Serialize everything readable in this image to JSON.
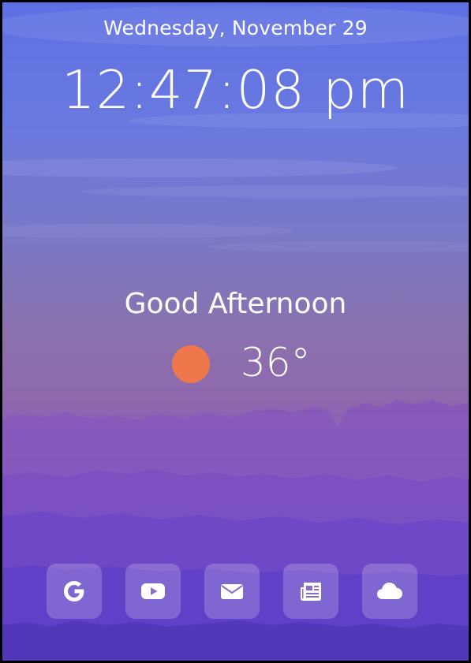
{
  "header": {
    "date": "Wednesday, November 29",
    "time": "12:47:08 pm"
  },
  "greeting": {
    "text": "Good Afternoon"
  },
  "weather": {
    "icon": "sun-icon",
    "temperature": "36°",
    "sun_color": "#ee774b"
  },
  "dock": {
    "items": [
      {
        "icon": "google-icon"
      },
      {
        "icon": "youtube-icon"
      },
      {
        "icon": "mail-icon"
      },
      {
        "icon": "news-icon"
      },
      {
        "icon": "cloud-icon"
      }
    ]
  },
  "colors": {
    "sky_top": "#5d6fe3",
    "sky_mid": "#8a72ad",
    "mountain_far": "#8a5cc0",
    "mountain_near": "#5a3ec8"
  }
}
